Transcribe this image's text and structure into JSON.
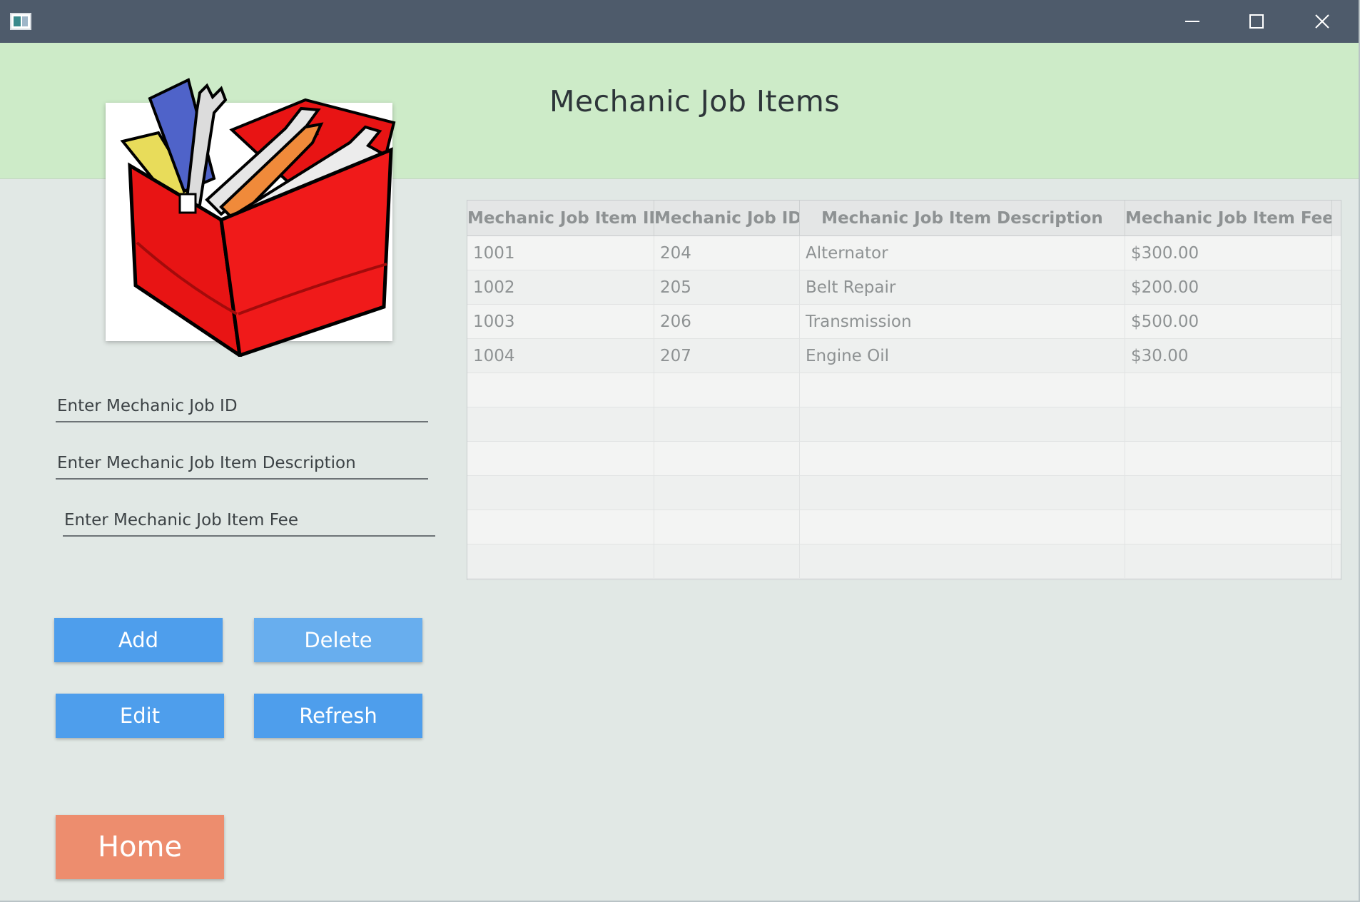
{
  "window": {
    "title": ""
  },
  "header": {
    "title": "Mechanic Job Items"
  },
  "form": {
    "job_id": {
      "value": "",
      "placeholder": "Enter Mechanic Job ID"
    },
    "description": {
      "value": "",
      "placeholder": "Enter Mechanic Job Item Description"
    },
    "fee": {
      "value": "",
      "placeholder": "Enter Mechanic Job Item Fee"
    }
  },
  "buttons": {
    "add": "Add",
    "delete": "Delete",
    "edit": "Edit",
    "refresh": "Refresh",
    "home": "Home"
  },
  "table": {
    "columns": [
      "Mechanic Job Item ID",
      "Mechanic Job ID",
      "Mechanic Job Item Description",
      "Mechanic Job Item Fee"
    ],
    "rows": [
      [
        "1001",
        "204",
        "Alternator",
        "$300.00"
      ],
      [
        "1002",
        "205",
        "Belt Repair",
        "$200.00"
      ],
      [
        "1003",
        "206",
        "Transmission",
        "$500.00"
      ],
      [
        "1004",
        "207",
        "Engine Oil",
        "$30.00"
      ]
    ]
  },
  "colors": {
    "header_bg": "#cdebc8",
    "window_bg": "#e1e8e5",
    "titlebar_bg": "#4e5b6b",
    "button_blue": "#4e9eec",
    "button_home": "#ed8d6e"
  },
  "icons": [
    "app-icon",
    "minimize-icon",
    "maximize-icon",
    "close-icon",
    "toolbox-logo"
  ]
}
